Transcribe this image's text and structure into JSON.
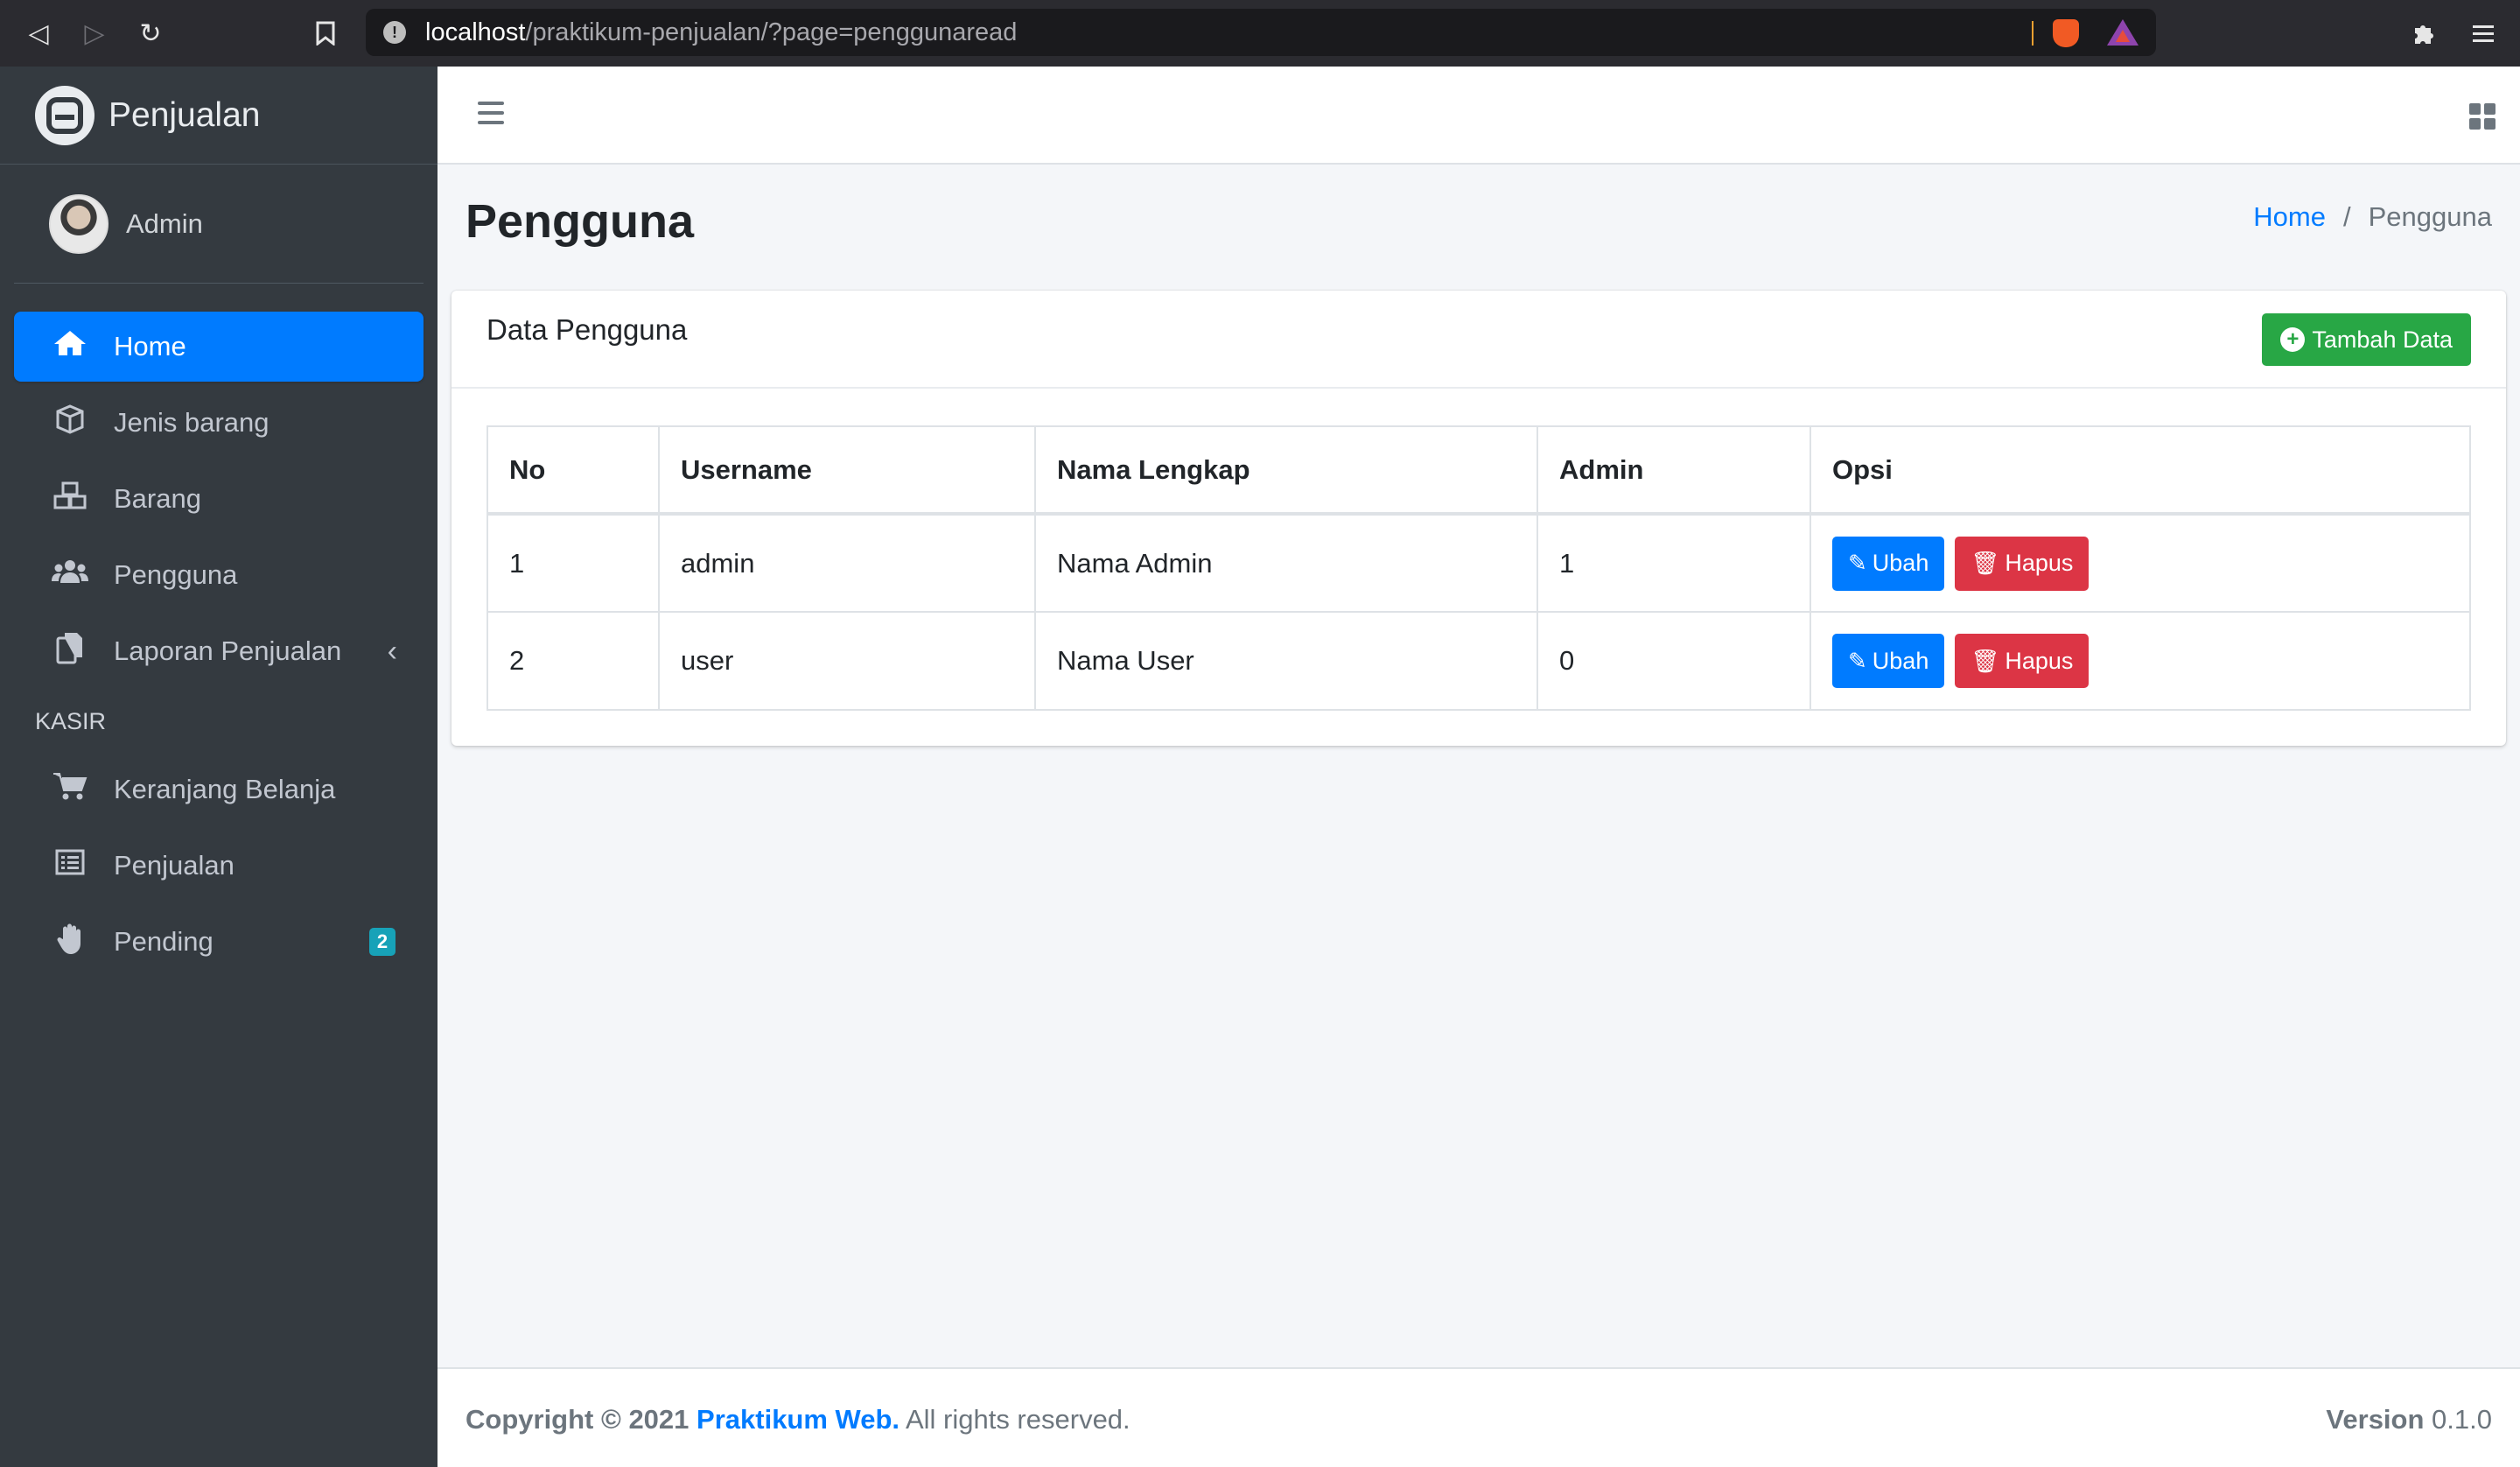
{
  "browser": {
    "url_host": "localhost",
    "url_path": "/praktikum-penjualan/?page=penggunaread"
  },
  "sidebar": {
    "brand": "Penjualan",
    "user": "Admin",
    "items": [
      {
        "label": "Home",
        "icon": "home-icon",
        "active": true
      },
      {
        "label": "Jenis barang",
        "icon": "box-icon"
      },
      {
        "label": "Barang",
        "icon": "boxes-icon"
      },
      {
        "label": "Pengguna",
        "icon": "users-icon"
      },
      {
        "label": "Laporan Penjualan",
        "icon": "copy-icon"
      }
    ],
    "section_header": "KASIR",
    "kasir_items": [
      {
        "label": "Keranjang Belanja",
        "icon": "cart-icon"
      },
      {
        "label": "Penjualan",
        "icon": "list-icon"
      },
      {
        "label": "Pending",
        "icon": "hand-icon",
        "badge": "2"
      }
    ]
  },
  "page": {
    "title": "Pengguna",
    "breadcrumb": {
      "home": "Home",
      "separator": "/",
      "current": "Pengguna"
    }
  },
  "card": {
    "title": "Data Pengguna",
    "add_button": "Tambah Data"
  },
  "table": {
    "headers": [
      "No",
      "Username",
      "Nama Lengkap",
      "Admin",
      "Opsi"
    ],
    "rows": [
      {
        "no": "1",
        "username": "admin",
        "nama": "Nama Admin",
        "admin": "1"
      },
      {
        "no": "2",
        "username": "user",
        "nama": "Nama User",
        "admin": "0"
      }
    ],
    "edit_label": "Ubah",
    "delete_label": "Hapus"
  },
  "footer": {
    "copyright": "Copyright © 2021",
    "brand": "Praktikum Web.",
    "rights": "All rights reserved.",
    "version_label": "Version",
    "version": "0.1.0"
  },
  "colors": {
    "sidebar_bg": "#343a40",
    "accent": "#007bff",
    "success": "#28a745",
    "danger": "#dc3545",
    "badge": "#17a2b8"
  }
}
